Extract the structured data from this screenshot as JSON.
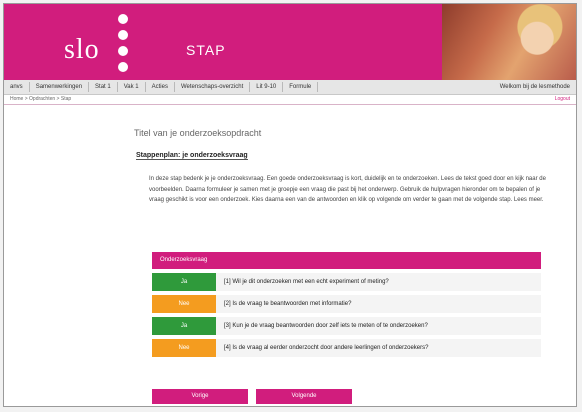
{
  "header": {
    "logo_text": "slo",
    "app_name": "STAP"
  },
  "nav": {
    "items": [
      "anvs",
      "Samenwerkingen",
      "Stat 1",
      "Vak 1",
      "Acties",
      "Wetenschaps-overzicht",
      "Lit 9-10",
      "Formule"
    ],
    "right_text": "Welkom bij de lesmethode"
  },
  "subbar": {
    "left": "Home > Opdrachten > Stap",
    "right": "Logout"
  },
  "page": {
    "title": "Titel van je onderzoeksopdracht",
    "section_label": "Stappenplan: je onderzoeksvraag"
  },
  "body_text": "In deze stap bedenk je je onderzoeksvraag. Een goede onderzoeksvraag is kort, duidelijk en te onderzoeken. Lees de tekst goed door en kijk naar de voorbeelden. Daarna formuleer je samen met je groepje een vraag die past bij het onderwerp. Gebruik de hulpvragen hieronder om te bepalen of je vraag geschikt is voor een onderzoek. Kies daarna een van de antwoorden en klik op volgende om verder te gaan met de volgende stap. Lees meer.",
  "panel": {
    "heading": "Onderzoeksvraag",
    "options": [
      {
        "button": "Ja",
        "text": "[1] Wil je dit onderzoeken met een echt experiment of meting?",
        "color": "#2f9a3b"
      },
      {
        "button": "Nee",
        "text": "[2] Is de vraag te beantwoorden met informatie?",
        "color": "#f49c1f"
      },
      {
        "button": "Ja",
        "text": "[3] Kun je de vraag beantwoorden door zelf iets te meten of te onderzoeken?",
        "color": "#2f9a3b"
      },
      {
        "button": "Nee",
        "text": "[4] Is de vraag al eerder onderzocht door andere leerlingen of onderzoekers?",
        "color": "#f49c1f"
      }
    ]
  },
  "buttons": {
    "left": "Vorige",
    "right": "Volgende"
  },
  "colors": {
    "brand": "#d11d7d",
    "green": "#2f9a3b",
    "orange": "#f49c1f"
  }
}
